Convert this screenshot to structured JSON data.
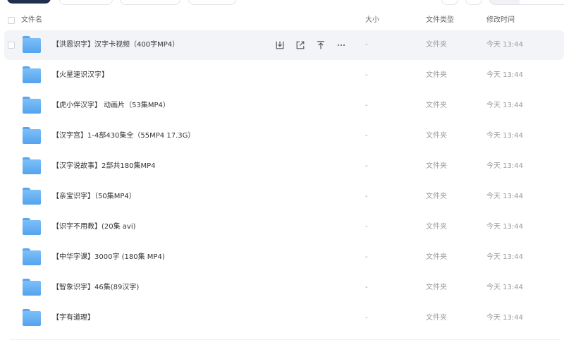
{
  "header": {
    "name_label": "文件名",
    "size_label": "大小",
    "type_label": "文件类型",
    "time_label": "修改时间"
  },
  "rows": [
    {
      "name": "【洪恩识字】汉字卡视频（400字MP4）",
      "size": "-",
      "type": "文件夹",
      "time": "今天 13:44"
    },
    {
      "name": "【火星速识汉字】",
      "size": "-",
      "type": "文件夹",
      "time": "今天 13:44"
    },
    {
      "name": "【虎小伴汉字】 动画片（53集MP4）",
      "size": "-",
      "type": "文件夹",
      "time": "今天 13:44"
    },
    {
      "name": "【汉字宫】1-4部430集全（55MP4 17.3G）",
      "size": "-",
      "type": "文件夹",
      "time": "今天 13:44"
    },
    {
      "name": "【汉字说故事】2部共180集MP4",
      "size": "-",
      "type": "文件夹",
      "time": "今天 13:44"
    },
    {
      "name": "【亲宝识字】（50集MP4）",
      "size": "-",
      "type": "文件夹",
      "time": "今天 13:44"
    },
    {
      "name": "【识字不用教】(20集 avi)",
      "size": "-",
      "type": "文件夹",
      "time": "今天 13:44"
    },
    {
      "name": "【中华字课】3000字 (180集 MP4)",
      "size": "-",
      "type": "文件夹",
      "time": "今天 13:44"
    },
    {
      "name": "【智象识字】46集(89汉字)",
      "size": "-",
      "type": "文件夹",
      "time": "今天 13:44"
    },
    {
      "name": "【字有道理】",
      "size": "-",
      "type": "文件夹",
      "time": "今天 13:44"
    }
  ],
  "icons": {
    "download": "download-icon",
    "share": "share-icon",
    "pin_top": "pin-to-top-icon",
    "more": "more-icon"
  }
}
